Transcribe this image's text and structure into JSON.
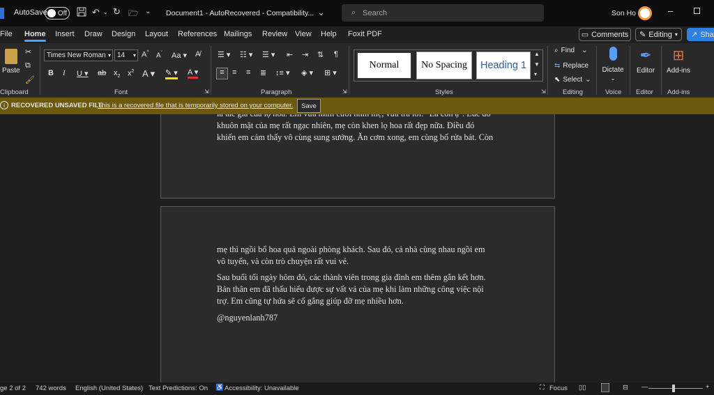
{
  "titlebar": {
    "autosave_label": "AutoSave",
    "autosave_state": "Off",
    "doc_title": "Document1  -  AutoRecovered  -  Compatibility...",
    "search_placeholder": "Search",
    "user_name": "Son Ho"
  },
  "menu": {
    "file": "File",
    "home": "Home",
    "insert": "Insert",
    "draw": "Draw",
    "design": "Design",
    "layout": "Layout",
    "references": "References",
    "mailings": "Mailings",
    "review": "Review",
    "view": "View",
    "help": "Help",
    "foxit": "Foxit PDF",
    "comments": "Comments",
    "editing": "Editing",
    "share": "Shar"
  },
  "ribbon": {
    "paste": "Paste",
    "font_name": "Times New Roman",
    "font_size": "14",
    "styles": {
      "normal": "Normal",
      "no_spacing": "No Spacing",
      "heading1": "Heading 1"
    },
    "find": "Find",
    "replace": "Replace",
    "select": "Select",
    "dictate": "Dictate",
    "editor": "Editor",
    "addins": "Add-ins",
    "groups": {
      "clipboard": "Clipboard",
      "font": "Font",
      "paragraph": "Paragraph",
      "styles": "Styles",
      "editing": "Editing",
      "voice": "Voice",
      "editor": "Editor",
      "addins": "Add-ins"
    }
  },
  "infobar": {
    "title": "RECOVERED UNSAVED FILE",
    "message": "This is a recovered file that is temporarily stored on your computer.",
    "save": "Save"
  },
  "document": {
    "page1_lines": [
      "là tác giả của lọ hoa. Em vừa mỉm cười nhìn mẹ, vừa trả lời: \"Là con ạ\". Lúc đó",
      "khuôn mặt của mẹ rất ngạc nhiên, mẹ còn khen lọ hoa rất đẹp nữa. Điều đó",
      "khiến em cảm thấy vô cùng sung sướng. Ăn cơm xong, em cùng bố rửa bát. Còn"
    ],
    "page2_para1": [
      "mẹ thì ngồi bổ hoa quả ngoài phòng khách. Sau đó, cả nhà cùng nhau ngồi em",
      "vô tuyến, và còn trò chuyện rất vui vẻ."
    ],
    "page2_para2": [
      "Sau buổi tối ngày hôm đó, các thành viên trong gia đình em thêm gắn kết hơn.",
      "Bản thân em đã thấu hiểu được sự vất vả của mẹ khi làm những công việc nội",
      "trợ. Em cũng tự hứa sẽ cố gắng giúp đỡ mẹ nhiều hơn."
    ],
    "signature": "@nguyenlanh787"
  },
  "status": {
    "page": "ge 2 of 2",
    "words": "742 words",
    "language": "English (United States)",
    "predictions": "Text Predictions: On",
    "accessibility": "Accessibility: Unavailable",
    "focus": "Focus"
  },
  "colors": {
    "accent": "#4aa3ff",
    "infobar": "#6b5a0e",
    "share": "#2f7fe0"
  }
}
